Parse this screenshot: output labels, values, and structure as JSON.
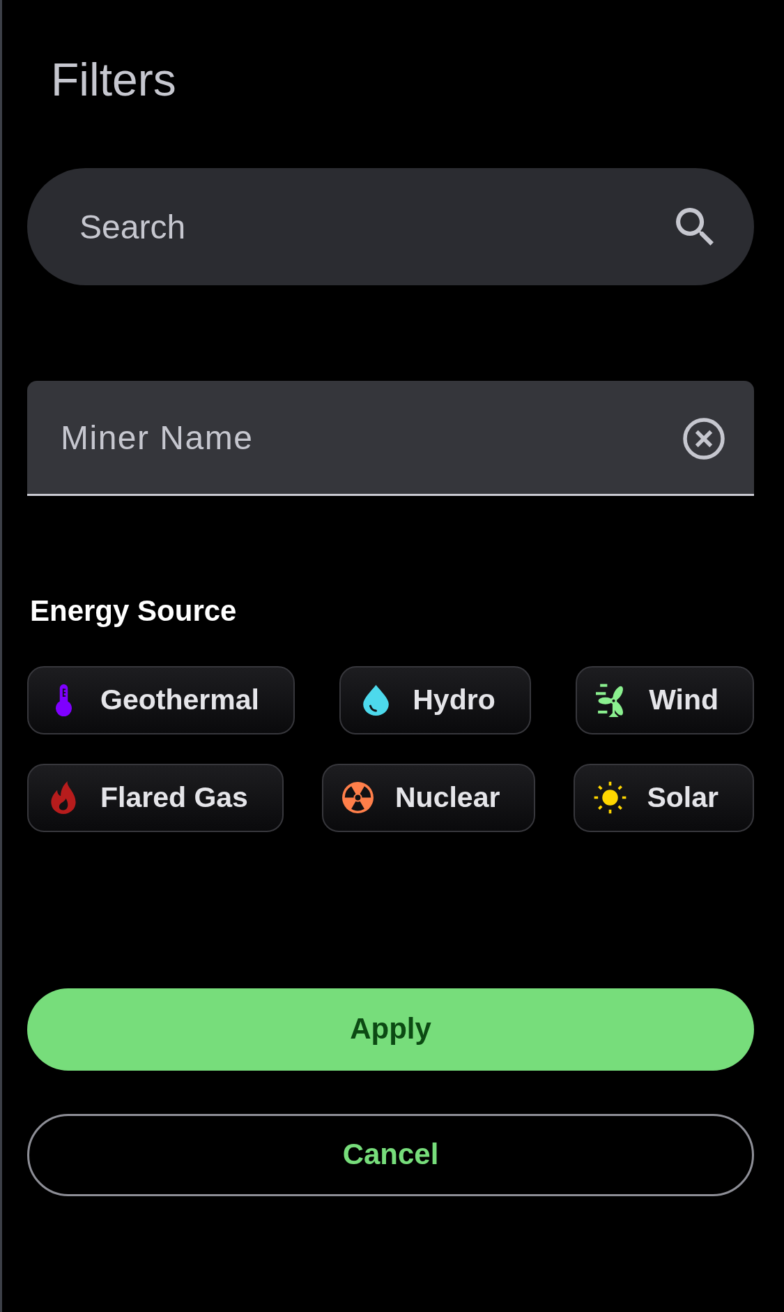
{
  "title": "Filters",
  "search": {
    "placeholder": "Search"
  },
  "miner_name": {
    "placeholder": "Miner Name"
  },
  "energy_source": {
    "label": "Energy Source",
    "options": [
      {
        "label": "Geothermal",
        "kind": "thermometer",
        "color": "#7f00ff",
        "selected": false
      },
      {
        "label": "Hydro",
        "kind": "drop",
        "color": "#4dd9ec",
        "selected": false
      },
      {
        "label": "Wind",
        "kind": "turbine",
        "color": "#8bf08f",
        "selected": false
      },
      {
        "label": "Flared Gas",
        "kind": "flame",
        "color": "#b71c1c",
        "selected": false
      },
      {
        "label": "Nuclear",
        "kind": "radiation",
        "color": "#ff7f4a",
        "selected": false
      },
      {
        "label": "Solar",
        "kind": "sun",
        "color": "#ffd600",
        "selected": false
      }
    ]
  },
  "buttons": [
    {
      "label": "Apply",
      "kind": "filled"
    },
    {
      "label": "Cancel",
      "kind": "outlined"
    }
  ]
}
